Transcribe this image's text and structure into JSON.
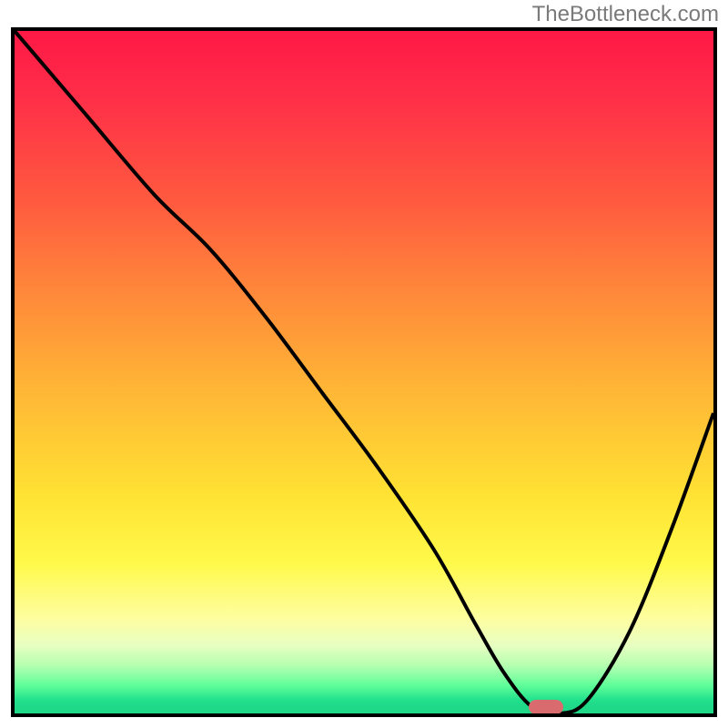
{
  "watermark": "TheBottleneck.com",
  "colors": {
    "curve": "#000000",
    "marker": "#d96b6f"
  },
  "chart_data": {
    "type": "line",
    "title": "",
    "xlabel": "",
    "ylabel": "",
    "xlim": [
      0,
      100
    ],
    "ylim": [
      0,
      100
    ],
    "grid": false,
    "legend": false,
    "background_gradient": "red-yellow-green (top to bottom)",
    "series": [
      {
        "name": "bottleneck-curve",
        "x": [
          0,
          10,
          20,
          28,
          36,
          44,
          52,
          60,
          66,
          70,
          74,
          78,
          82,
          88,
          94,
          100
        ],
        "y": [
          100,
          88,
          76,
          68,
          58,
          47,
          36,
          24,
          13,
          6,
          1,
          0,
          2,
          12,
          27,
          44
        ]
      }
    ],
    "marker": {
      "x": 76,
      "y": 0,
      "shape": "pill"
    }
  }
}
